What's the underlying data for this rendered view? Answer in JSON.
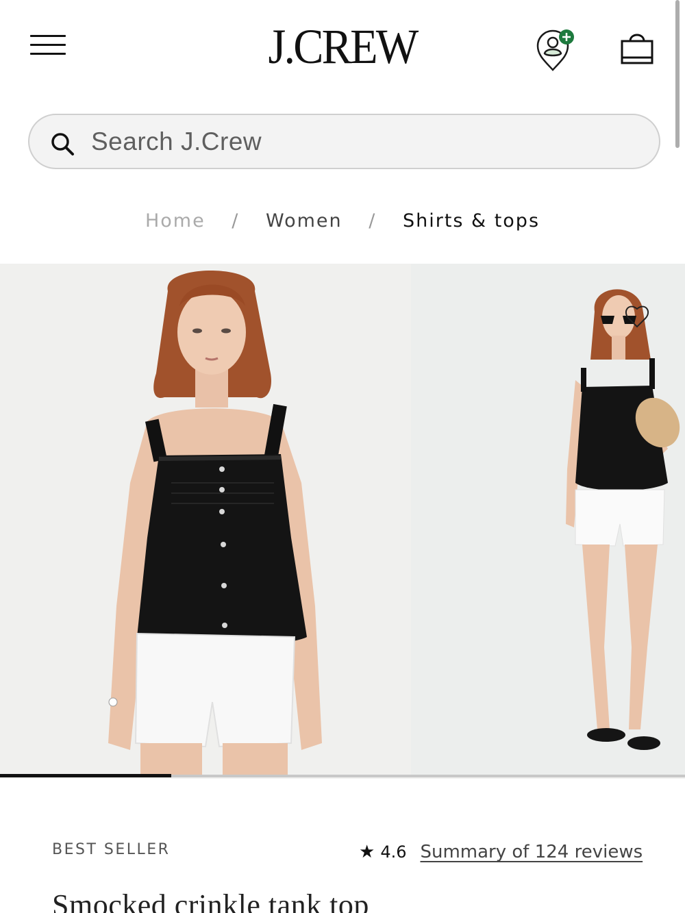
{
  "header": {
    "logo": "J.CREW",
    "menu_icon": "hamburger-menu-icon",
    "account_icon": "account-add-icon",
    "bag_icon": "shopping-bag-icon",
    "accent_color": "#1e7a3e"
  },
  "search": {
    "placeholder": "Search J.Crew",
    "value": ""
  },
  "breadcrumb": {
    "items": [
      "Home",
      "Women",
      "Shirts & tops"
    ],
    "separator": "/"
  },
  "gallery": {
    "progress": 0.25,
    "slides": [
      "model-front-view",
      "model-full-length-view"
    ]
  },
  "product": {
    "badge": "BEST SELLER",
    "rating": "4.6",
    "reviews_link": "Summary of 124 reviews",
    "title": "Smocked crinkle tank top"
  }
}
